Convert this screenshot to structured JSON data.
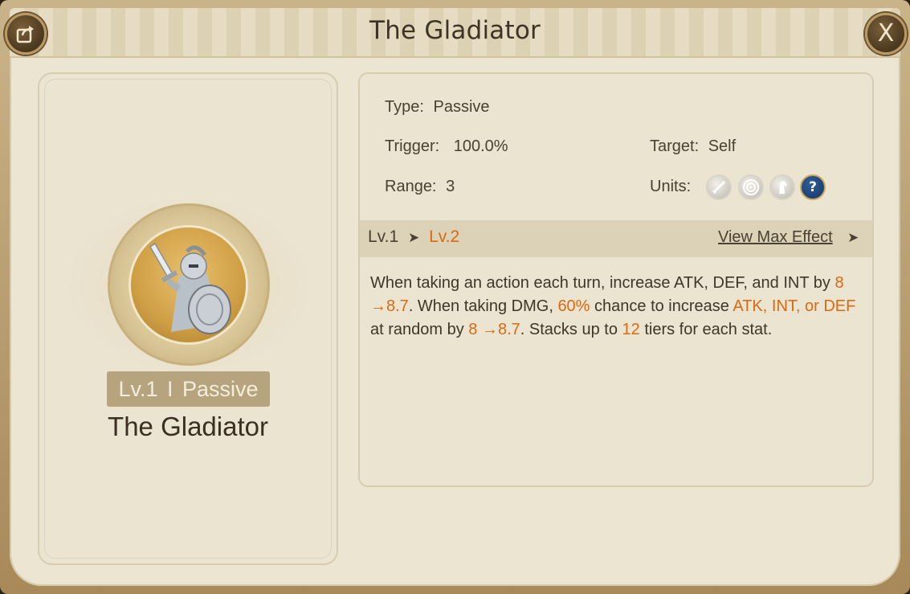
{
  "window": {
    "title": "The Gladiator"
  },
  "header": {
    "share_icon": "share-icon",
    "close_label": "X"
  },
  "skill_card": {
    "badge_level": "Lv.1",
    "badge_sep": "I",
    "badge_type": "Passive",
    "name": "The Gladiator"
  },
  "info": {
    "type_label": "Type:",
    "type_value": "Passive",
    "trigger_label": "Trigger:",
    "trigger_value": "100.0%",
    "target_label": "Target:",
    "target_value": "Self",
    "range_label": "Range:",
    "range_value": "3",
    "units_label": "Units:",
    "units_icons": [
      "sword-icon",
      "target-icon",
      "horse-icon",
      "question-icon"
    ]
  },
  "level_bar": {
    "current": "Lv.1",
    "next": "Lv.2",
    "view_max": "View Max Effect"
  },
  "description": {
    "p1": "When taking an action each turn, increase ATK, DEF, and INT by ",
    "v1": "8 →8.7",
    "p2": ". When taking DMG, ",
    "v2": "60%",
    "p3": " chance to increase ",
    "v3": "ATK, INT, or DEF",
    "p4": " at random by ",
    "v4": "8 →8.7",
    "p5": ". Stacks up to ",
    "v5": "12",
    "p6": " tiers for each stat."
  },
  "colors": {
    "highlight": "#d96a12",
    "panel": "#ece5d2",
    "badge": "#b5a47e"
  }
}
